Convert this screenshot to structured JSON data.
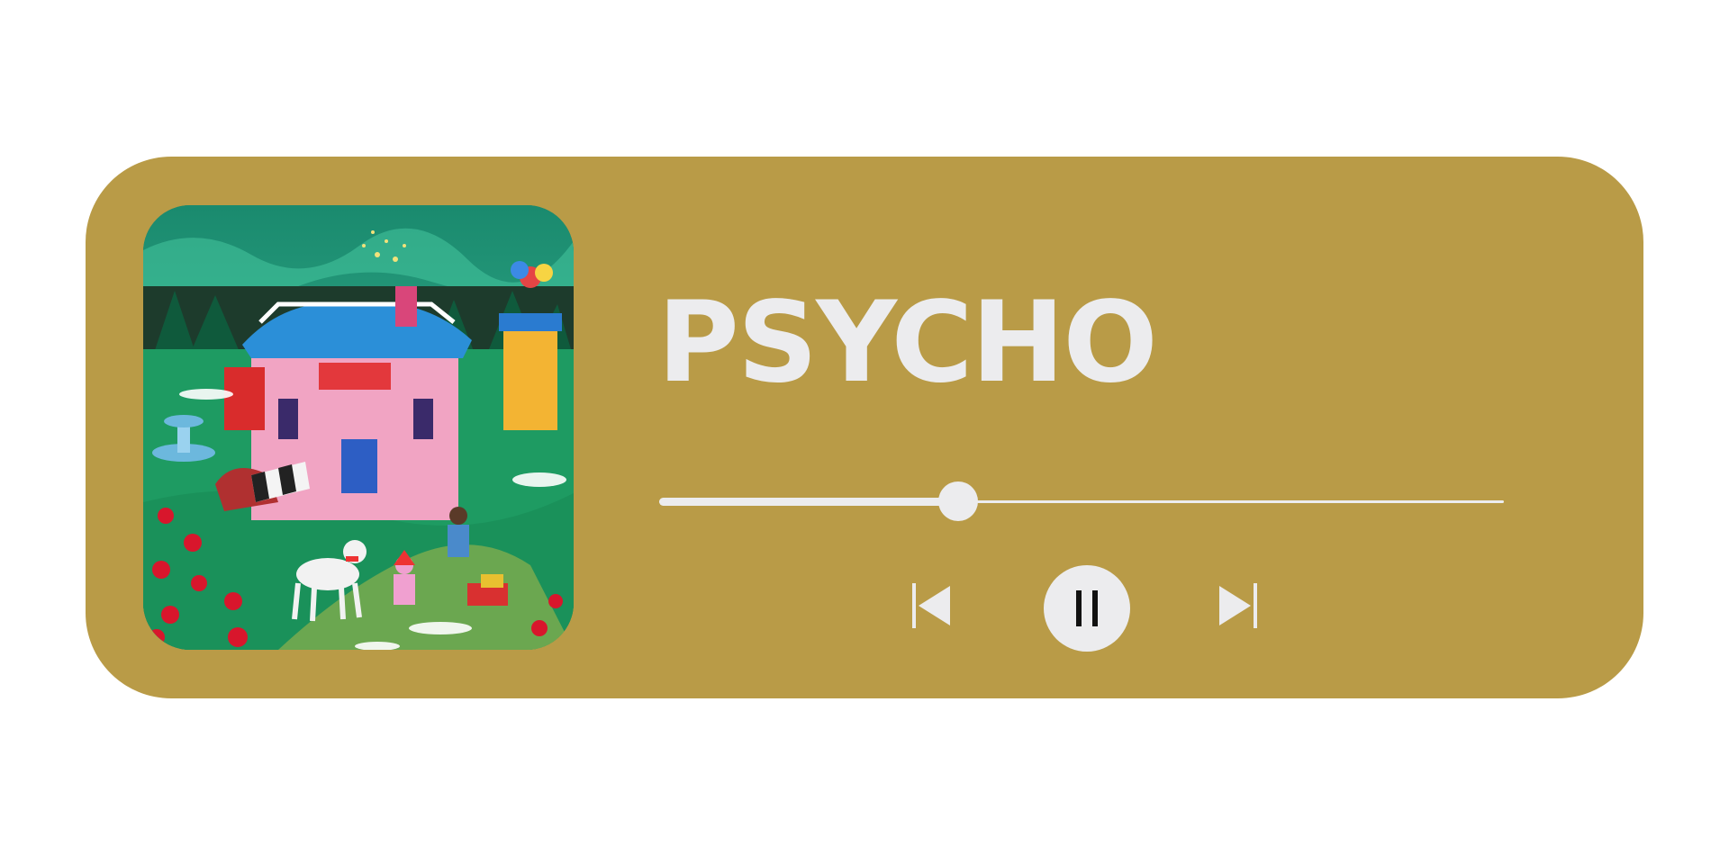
{
  "player": {
    "title": "PSYCHO",
    "progress_fraction": 0.354,
    "card_color": "#B99B47",
    "foreground_color": "#ECECEE",
    "album_art_icon": "album-cover-illustration",
    "controls": {
      "previous_icon": "skip-previous-icon",
      "pause_icon": "pause-icon",
      "next_icon": "skip-next-icon"
    }
  }
}
